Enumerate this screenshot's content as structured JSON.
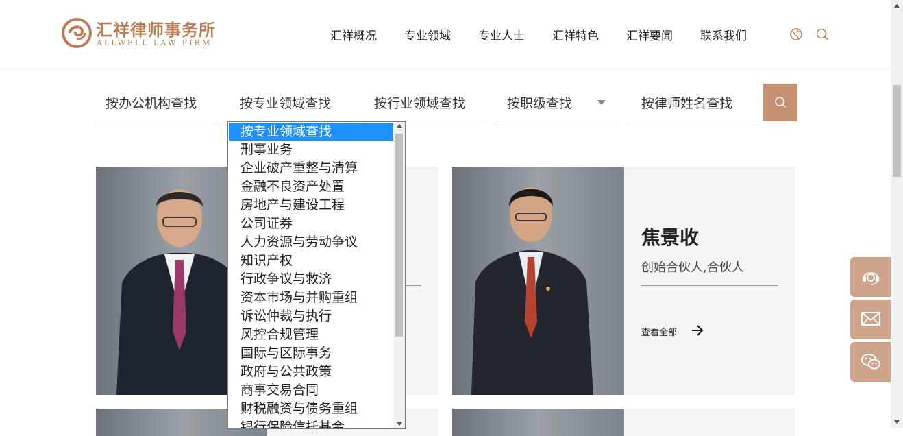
{
  "brand": {
    "name_cn": "汇祥律师事务所",
    "name_en": "ALLWELL LAW FIRM",
    "color": "#b97e55"
  },
  "nav": [
    "汇祥概况",
    "专业领域",
    "专业人士",
    "汇祥特色",
    "汇祥要闻",
    "联系我们"
  ],
  "nav_icons": [
    "globe-icon",
    "search-icon"
  ],
  "filters": {
    "office": "按办公机构查找",
    "practice": "按专业领域查找",
    "industry": "按行业领域查找",
    "rank": "按职级查找",
    "name": "按律师姓名查找"
  },
  "dropdown": {
    "selected": "按专业领域查找",
    "options": [
      "按专业领域查找",
      "刑事业务",
      "企业破产重整与清算",
      "金融不良资产处置",
      "房地产与建设工程",
      "公司证券",
      "人力资源与劳动争议",
      "知识产权",
      "行政争议与救济",
      "资本市场与并购重组",
      "诉讼仲裁与执行",
      "风控合规管理",
      "国际与区际事务",
      "政府与公共政策",
      "商事交易合同",
      "财税融资与债务重组",
      "银行保险信托基金"
    ]
  },
  "lawyer2": {
    "name": "焦景收",
    "title": "创始合伙人,合伙人",
    "more": "查看全部"
  },
  "side_buttons": [
    "headset-icon",
    "mail-icon",
    "wechat-icon"
  ],
  "colors": {
    "accent": "#c49272",
    "side": "#cfa48c",
    "selected": "#1e90ff"
  }
}
